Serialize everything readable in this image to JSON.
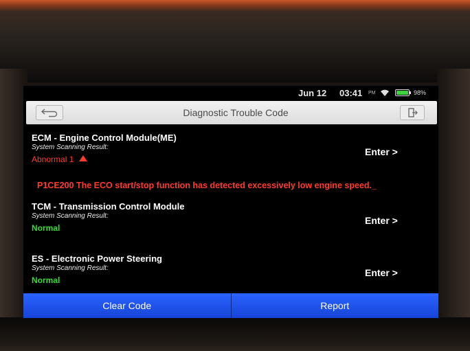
{
  "status_bar": {
    "date": "Jun 12",
    "time": "03:41",
    "ampm": "PM",
    "battery": "98%",
    "battery_level": 0.98,
    "wifi_icon": "wifi-icon"
  },
  "header": {
    "title": "Diagnostic Trouble Code",
    "back_icon": "back-icon",
    "exit_icon": "exit-icon"
  },
  "modules": [
    {
      "name": "ECM - Engine Control Module(ME)",
      "scan_label": "System Scanning Result:",
      "status": "Abnormal 1",
      "enter_label": "Enter >",
      "dtc": "P1CE200 The ECO start/stop function has detected excessively low engine speed._"
    },
    {
      "name": "TCM - Transmission Control Module",
      "scan_label": "System Scanning Result:",
      "status": "Normal",
      "enter_label": "Enter >"
    },
    {
      "name": "ES - Electronic Power Steering",
      "scan_label": "System Scanning Result:",
      "status": "Normal",
      "enter_label": "Enter >"
    }
  ],
  "footer": {
    "clear_code": "Clear Code",
    "report": "Report"
  },
  "colors": {
    "abnormal": "#ff3b30",
    "normal": "#33dd33",
    "button": "#2a63ff"
  }
}
